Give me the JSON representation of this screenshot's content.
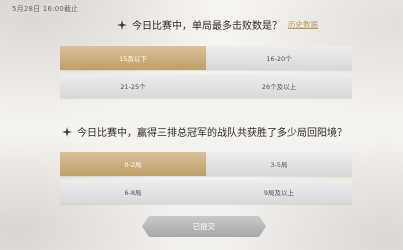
{
  "deadline": "5月28日 16:00截止",
  "questions": [
    {
      "text": "今日比赛中，单局最多击败数是？",
      "history_link": "历史数据",
      "options": [
        "15及以下",
        "16-20个",
        "21-25个",
        "26个及以上"
      ],
      "selected_index": 0
    },
    {
      "text": "今日比赛中，赢得三排总冠军的战队共获胜了多少局回阳境？",
      "options": [
        "0-2局",
        "3-5局",
        "6-8局",
        "9局及以上"
      ],
      "selected_index": 0
    }
  ],
  "submit_label": "已提交",
  "colors": {
    "selected_option": "#c8aa75",
    "unselected_option": "#e2e2e2",
    "link": "#b89a5b",
    "submit_disabled": "#b9b9b9"
  },
  "icons": [
    "sparkle-icon"
  ]
}
